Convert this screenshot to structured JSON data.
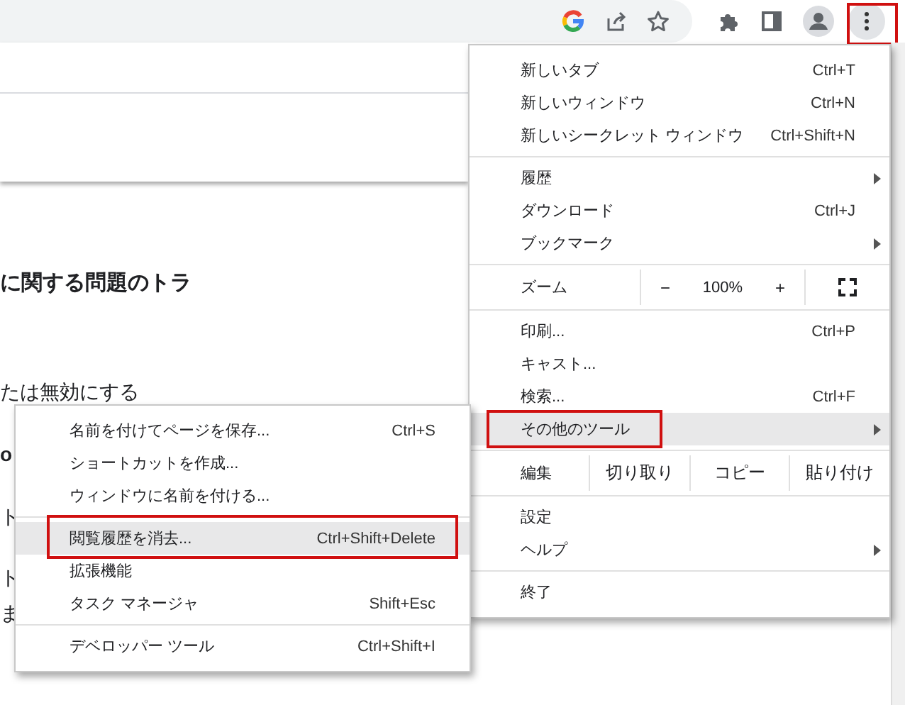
{
  "toolbar": {
    "more_button_annotated": true
  },
  "page": {
    "heading": "に関する問題のトラ",
    "lines": [
      {
        "text": "たは無効にする",
        "bold": false
      },
      {
        "text": "o",
        "bold": true
      },
      {
        "text": "ト",
        "bold": false
      },
      {
        "text": "ト",
        "bold": false
      },
      {
        "text": "ま",
        "bold": false
      }
    ]
  },
  "main_menu": {
    "sections": [
      [
        {
          "kind": "item",
          "label": "新しいタブ",
          "shortcut": "Ctrl+T",
          "submenu": false,
          "selected": false,
          "annotated": false
        },
        {
          "kind": "item",
          "label": "新しいウィンドウ",
          "shortcut": "Ctrl+N",
          "submenu": false,
          "selected": false,
          "annotated": false
        },
        {
          "kind": "item",
          "label": "新しいシークレット ウィンドウ",
          "shortcut": "Ctrl+Shift+N",
          "submenu": false,
          "selected": false,
          "annotated": false
        }
      ],
      [
        {
          "kind": "item",
          "label": "履歴",
          "submenu": true,
          "selected": false,
          "annotated": false
        },
        {
          "kind": "item",
          "label": "ダウンロード",
          "shortcut": "Ctrl+J",
          "submenu": false,
          "selected": false,
          "annotated": false
        },
        {
          "kind": "item",
          "label": "ブックマーク",
          "submenu": true,
          "selected": false,
          "annotated": false
        }
      ],
      [
        {
          "kind": "zoom",
          "label": "ズーム",
          "minus": "−",
          "value": "100%",
          "plus": "+"
        }
      ],
      [
        {
          "kind": "item",
          "label": "印刷...",
          "shortcut": "Ctrl+P",
          "submenu": false,
          "selected": false,
          "annotated": false
        },
        {
          "kind": "item",
          "label": "キャスト...",
          "submenu": false,
          "selected": false,
          "annotated": false
        },
        {
          "kind": "item",
          "label": "検索...",
          "shortcut": "Ctrl+F",
          "submenu": false,
          "selected": false,
          "annotated": false
        },
        {
          "kind": "item",
          "label": "その他のツール",
          "submenu": true,
          "selected": true,
          "annotated": true
        }
      ],
      [
        {
          "kind": "edit",
          "label": "編集",
          "actions": [
            "切り取り",
            "コピー",
            "貼り付け"
          ]
        }
      ],
      [
        {
          "kind": "item",
          "label": "設定",
          "submenu": false,
          "selected": false,
          "annotated": false
        },
        {
          "kind": "item",
          "label": "ヘルプ",
          "submenu": true,
          "selected": false,
          "annotated": false
        }
      ],
      [
        {
          "kind": "item",
          "label": "終了",
          "submenu": false,
          "selected": false,
          "annotated": false
        }
      ]
    ]
  },
  "sub_menu": {
    "sections": [
      [
        {
          "kind": "item",
          "label": "名前を付けてページを保存...",
          "shortcut": "Ctrl+S",
          "submenu": false,
          "selected": false,
          "annotated": false
        },
        {
          "kind": "item",
          "label": "ショートカットを作成...",
          "submenu": false,
          "selected": false,
          "annotated": false
        },
        {
          "kind": "item",
          "label": "ウィンドウに名前を付ける...",
          "submenu": false,
          "selected": false,
          "annotated": false
        }
      ],
      [
        {
          "kind": "item",
          "label": "閲覧履歴を消去...",
          "shortcut": "Ctrl+Shift+Delete",
          "submenu": false,
          "selected": true,
          "annotated": true
        },
        {
          "kind": "item",
          "label": "拡張機能",
          "submenu": false,
          "selected": false,
          "annotated": false
        },
        {
          "kind": "item",
          "label": "タスク マネージャ",
          "shortcut": "Shift+Esc",
          "submenu": false,
          "selected": false,
          "annotated": false
        }
      ],
      [
        {
          "kind": "item",
          "label": "デベロッパー ツール",
          "shortcut": "Ctrl+Shift+I",
          "submenu": false,
          "selected": false,
          "annotated": false
        }
      ]
    ]
  }
}
